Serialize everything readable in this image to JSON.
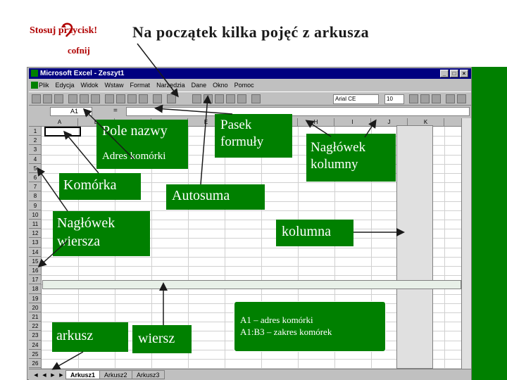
{
  "slide": {
    "title": "Na początek kilka pojęć z arkusza",
    "stosuj_label": "Stosuj przycisk!",
    "cofnij_label": "cofnij"
  },
  "excel": {
    "window_title": "Microsoft Excel - Zeszyt1",
    "menu": [
      "Plik",
      "Edycja",
      "Widok",
      "Wstaw",
      "Format",
      "Narzędzia",
      "Dane",
      "Okno",
      "Pomoc"
    ],
    "font_name": "Arial CE",
    "font_size": "10",
    "name_box": "A1",
    "formula_eq": "=",
    "columns": [
      "A",
      "B",
      "C",
      "D",
      "E",
      "F",
      "G",
      "H",
      "I",
      "J",
      "K"
    ],
    "rows": [
      "1",
      "2",
      "3",
      "4",
      "5",
      "6",
      "7",
      "8",
      "9",
      "10",
      "11",
      "12",
      "13",
      "14",
      "15",
      "16",
      "17",
      "18",
      "19",
      "20",
      "21",
      "22",
      "23",
      "24",
      "25",
      "26"
    ],
    "sheets": [
      "Arkusz1",
      "Arkusz2",
      "Arkusz3"
    ]
  },
  "annotations": {
    "pole_nazwy": "Pole nazwy",
    "adres_komorki": "Adres komórki",
    "komorka": "Komórka",
    "pasek_formuly": "Pasek formuły",
    "naglowek_kolumny": "Nagłówek kolumny",
    "autosuma": "Autosuma",
    "naglowek_wiersza": "Nagłówek wiersza",
    "kolumna": "kolumna",
    "arkusz": "arkusz",
    "wiersz": "wiersz",
    "info_line1": "A1 – adres komórki",
    "info_line2": "A1:B3 – zakres komórek"
  },
  "colors": {
    "annotation_bg": "#008000",
    "annotation_text": "#ffffff",
    "title_bar": "#000080",
    "accent_red": "#b00000"
  }
}
